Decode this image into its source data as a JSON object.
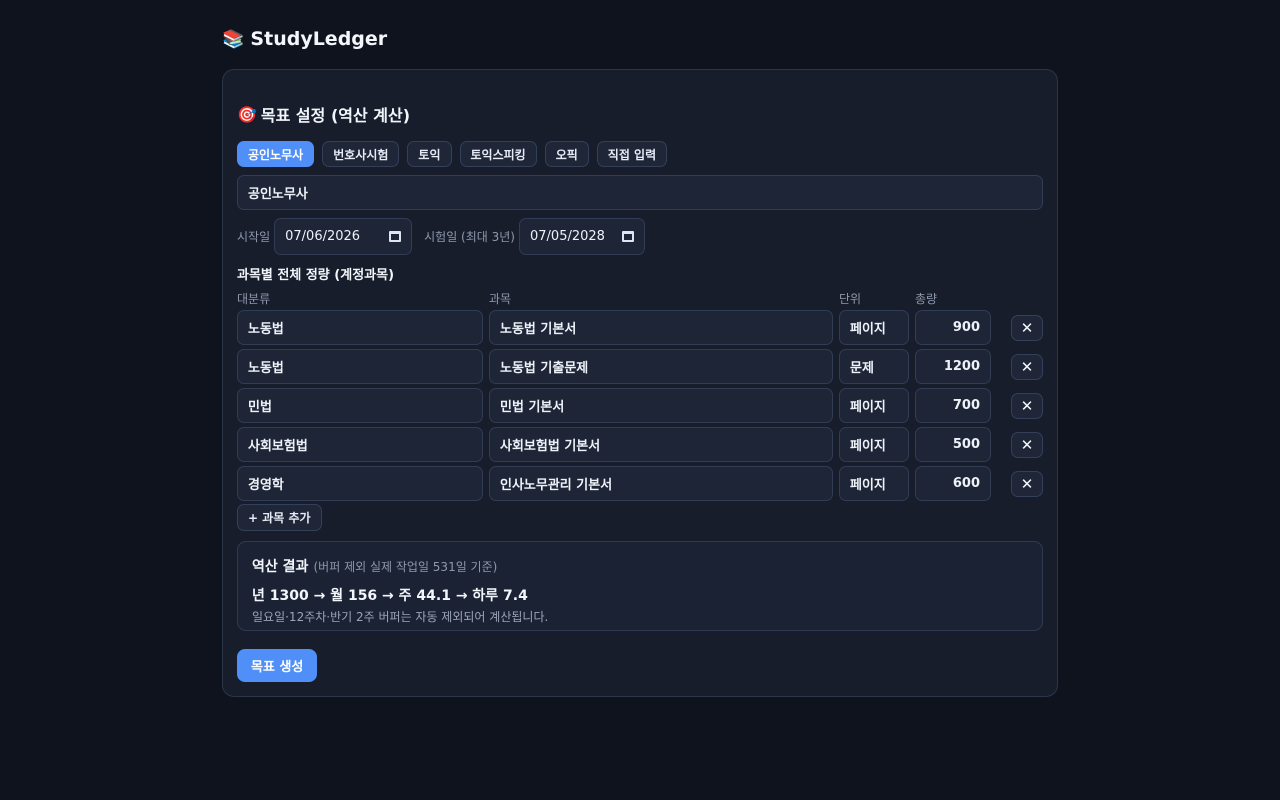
{
  "app": {
    "title": "StudyLedger",
    "logo_icon": "books-icon"
  },
  "goal": {
    "section_title": "목표 설정 (역산 계산)",
    "section_icon": "target-icon",
    "presets": [
      "공인노무사",
      "번호사시험",
      "토익",
      "토익스피킹",
      "오픽",
      "직접 입력"
    ],
    "active_preset": "공인노무사",
    "name_value": "공인노무사",
    "start_label": "시작일",
    "start_value": "07/06/2026",
    "exam_label": "시험일 (최대 3년)",
    "exam_value": "07/05/2028"
  },
  "subjects": {
    "title": "과목별 전체 정량 (계정과목)",
    "headers": {
      "category": "대분류",
      "subject": "과목",
      "unit": "단위",
      "amount": "총량"
    },
    "rows": [
      {
        "category": "노동법",
        "subject": "노동법 기본서",
        "unit": "페이지",
        "amount": "900"
      },
      {
        "category": "노동법",
        "subject": "노동법 기출문제",
        "unit": "문제",
        "amount": "1200"
      },
      {
        "category": "민법",
        "subject": "민법 기본서",
        "unit": "페이지",
        "amount": "700"
      },
      {
        "category": "사회보험법",
        "subject": "사회보험법 기본서",
        "unit": "페이지",
        "amount": "500"
      },
      {
        "category": "경영학",
        "subject": "인사노무관리 기본서",
        "unit": "페이지",
        "amount": "600"
      }
    ],
    "delete_symbol": "✕",
    "add_label": "+ 과목 추가"
  },
  "result": {
    "title": "역산 결과",
    "note": "(버퍼 제외 실제 작업일 531일 기준)",
    "main": "년 1300 → 월 156 → 주 44.1 → 하루 7.4",
    "sub": "일요일·12주차·반기 2주 버퍼는 자동 제외되어 계산됩니다."
  },
  "generate_label": "목표 생성",
  "colors": {
    "accent": "#4f8ff7",
    "background": "#0f131d",
    "card": "#171d2b"
  }
}
